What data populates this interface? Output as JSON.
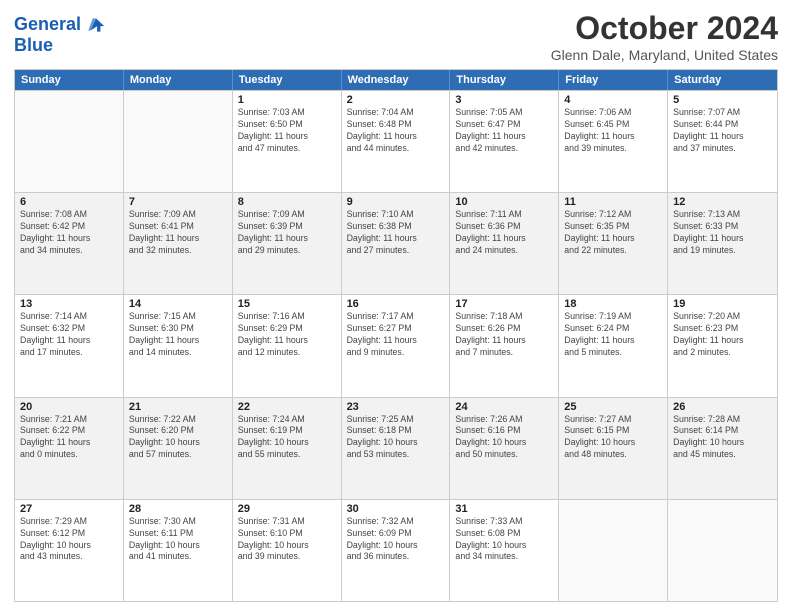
{
  "logo": {
    "line1": "General",
    "line2": "Blue"
  },
  "title": "October 2024",
  "location": "Glenn Dale, Maryland, United States",
  "days_of_week": [
    "Sunday",
    "Monday",
    "Tuesday",
    "Wednesday",
    "Thursday",
    "Friday",
    "Saturday"
  ],
  "rows": [
    [
      {
        "day": "",
        "info": ""
      },
      {
        "day": "",
        "info": ""
      },
      {
        "day": "1",
        "info": "Sunrise: 7:03 AM\nSunset: 6:50 PM\nDaylight: 11 hours\nand 47 minutes."
      },
      {
        "day": "2",
        "info": "Sunrise: 7:04 AM\nSunset: 6:48 PM\nDaylight: 11 hours\nand 44 minutes."
      },
      {
        "day": "3",
        "info": "Sunrise: 7:05 AM\nSunset: 6:47 PM\nDaylight: 11 hours\nand 42 minutes."
      },
      {
        "day": "4",
        "info": "Sunrise: 7:06 AM\nSunset: 6:45 PM\nDaylight: 11 hours\nand 39 minutes."
      },
      {
        "day": "5",
        "info": "Sunrise: 7:07 AM\nSunset: 6:44 PM\nDaylight: 11 hours\nand 37 minutes."
      }
    ],
    [
      {
        "day": "6",
        "info": "Sunrise: 7:08 AM\nSunset: 6:42 PM\nDaylight: 11 hours\nand 34 minutes."
      },
      {
        "day": "7",
        "info": "Sunrise: 7:09 AM\nSunset: 6:41 PM\nDaylight: 11 hours\nand 32 minutes."
      },
      {
        "day": "8",
        "info": "Sunrise: 7:09 AM\nSunset: 6:39 PM\nDaylight: 11 hours\nand 29 minutes."
      },
      {
        "day": "9",
        "info": "Sunrise: 7:10 AM\nSunset: 6:38 PM\nDaylight: 11 hours\nand 27 minutes."
      },
      {
        "day": "10",
        "info": "Sunrise: 7:11 AM\nSunset: 6:36 PM\nDaylight: 11 hours\nand 24 minutes."
      },
      {
        "day": "11",
        "info": "Sunrise: 7:12 AM\nSunset: 6:35 PM\nDaylight: 11 hours\nand 22 minutes."
      },
      {
        "day": "12",
        "info": "Sunrise: 7:13 AM\nSunset: 6:33 PM\nDaylight: 11 hours\nand 19 minutes."
      }
    ],
    [
      {
        "day": "13",
        "info": "Sunrise: 7:14 AM\nSunset: 6:32 PM\nDaylight: 11 hours\nand 17 minutes."
      },
      {
        "day": "14",
        "info": "Sunrise: 7:15 AM\nSunset: 6:30 PM\nDaylight: 11 hours\nand 14 minutes."
      },
      {
        "day": "15",
        "info": "Sunrise: 7:16 AM\nSunset: 6:29 PM\nDaylight: 11 hours\nand 12 minutes."
      },
      {
        "day": "16",
        "info": "Sunrise: 7:17 AM\nSunset: 6:27 PM\nDaylight: 11 hours\nand 9 minutes."
      },
      {
        "day": "17",
        "info": "Sunrise: 7:18 AM\nSunset: 6:26 PM\nDaylight: 11 hours\nand 7 minutes."
      },
      {
        "day": "18",
        "info": "Sunrise: 7:19 AM\nSunset: 6:24 PM\nDaylight: 11 hours\nand 5 minutes."
      },
      {
        "day": "19",
        "info": "Sunrise: 7:20 AM\nSunset: 6:23 PM\nDaylight: 11 hours\nand 2 minutes."
      }
    ],
    [
      {
        "day": "20",
        "info": "Sunrise: 7:21 AM\nSunset: 6:22 PM\nDaylight: 11 hours\nand 0 minutes."
      },
      {
        "day": "21",
        "info": "Sunrise: 7:22 AM\nSunset: 6:20 PM\nDaylight: 10 hours\nand 57 minutes."
      },
      {
        "day": "22",
        "info": "Sunrise: 7:24 AM\nSunset: 6:19 PM\nDaylight: 10 hours\nand 55 minutes."
      },
      {
        "day": "23",
        "info": "Sunrise: 7:25 AM\nSunset: 6:18 PM\nDaylight: 10 hours\nand 53 minutes."
      },
      {
        "day": "24",
        "info": "Sunrise: 7:26 AM\nSunset: 6:16 PM\nDaylight: 10 hours\nand 50 minutes."
      },
      {
        "day": "25",
        "info": "Sunrise: 7:27 AM\nSunset: 6:15 PM\nDaylight: 10 hours\nand 48 minutes."
      },
      {
        "day": "26",
        "info": "Sunrise: 7:28 AM\nSunset: 6:14 PM\nDaylight: 10 hours\nand 45 minutes."
      }
    ],
    [
      {
        "day": "27",
        "info": "Sunrise: 7:29 AM\nSunset: 6:12 PM\nDaylight: 10 hours\nand 43 minutes."
      },
      {
        "day": "28",
        "info": "Sunrise: 7:30 AM\nSunset: 6:11 PM\nDaylight: 10 hours\nand 41 minutes."
      },
      {
        "day": "29",
        "info": "Sunrise: 7:31 AM\nSunset: 6:10 PM\nDaylight: 10 hours\nand 39 minutes."
      },
      {
        "day": "30",
        "info": "Sunrise: 7:32 AM\nSunset: 6:09 PM\nDaylight: 10 hours\nand 36 minutes."
      },
      {
        "day": "31",
        "info": "Sunrise: 7:33 AM\nSunset: 6:08 PM\nDaylight: 10 hours\nand 34 minutes."
      },
      {
        "day": "",
        "info": ""
      },
      {
        "day": "",
        "info": ""
      }
    ]
  ]
}
